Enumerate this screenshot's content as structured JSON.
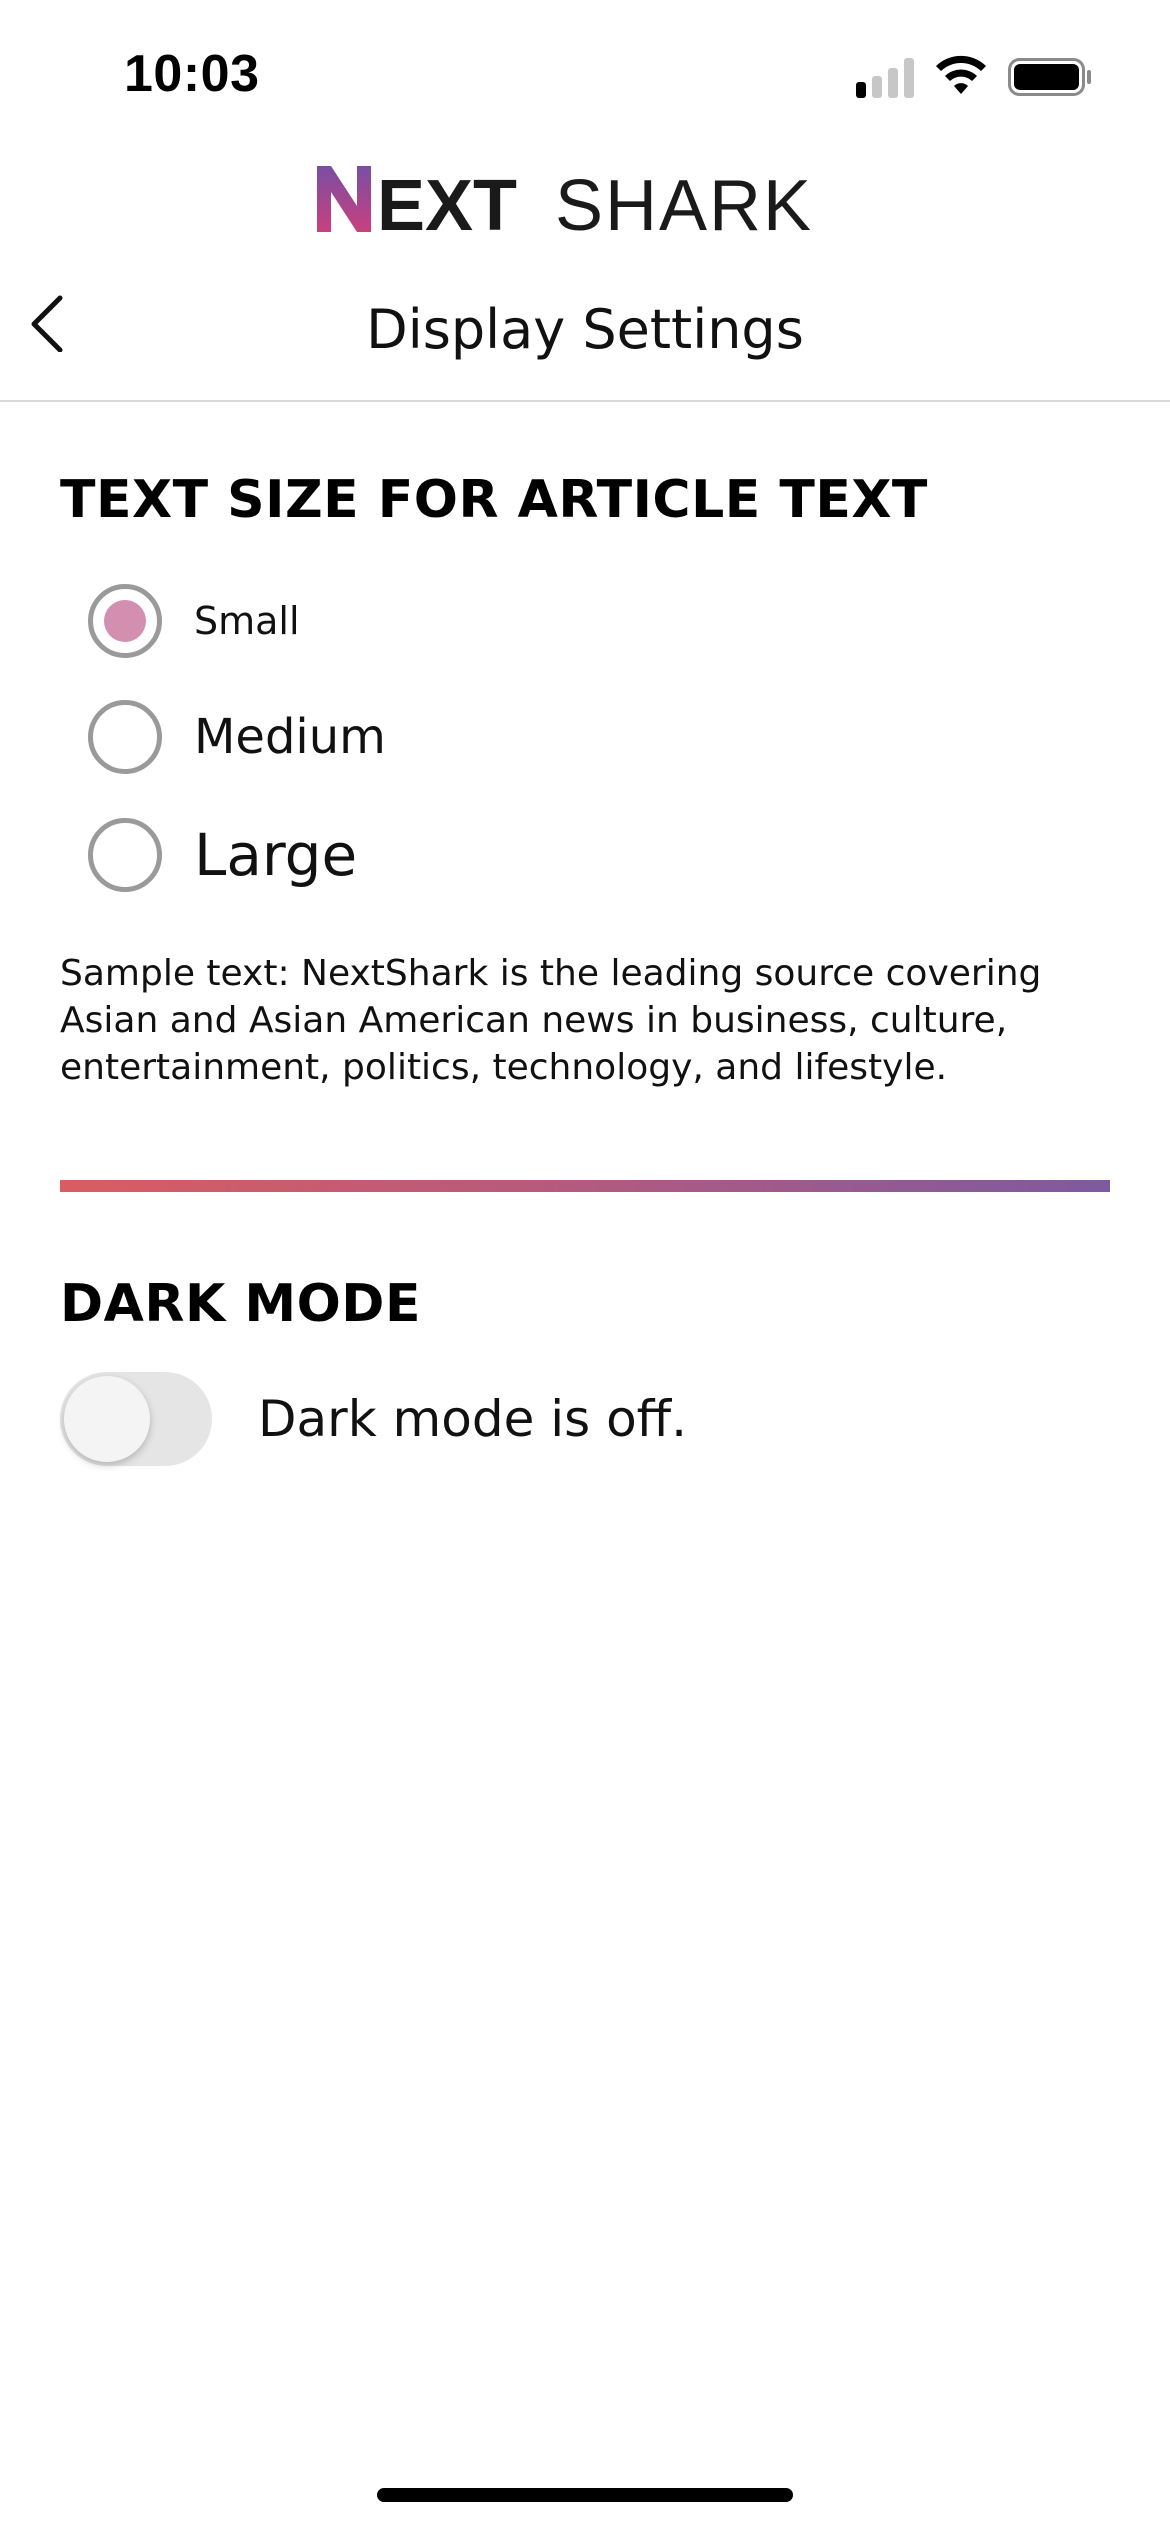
{
  "status_bar": {
    "time": "10:03",
    "signal_bars_active": 1,
    "signal_bars_total": 4
  },
  "logo": {
    "text_prefix": "N",
    "text_bold": "EXT",
    "text_light": "SHARK",
    "accent_gradient": [
      "#7a4ea3",
      "#c9407e"
    ]
  },
  "nav": {
    "title": "Display Settings",
    "back_icon": "chevron-left-icon"
  },
  "text_size": {
    "heading": "TEXT SIZE FOR ARTICLE TEXT",
    "options": [
      {
        "label": "Small",
        "selected": true
      },
      {
        "label": "Medium",
        "selected": false
      },
      {
        "label": "Large",
        "selected": false
      }
    ],
    "sample": "Sample text: NextShark is the leading source covering Asian and Asian American news in business, culture, entertainment, politics, technology, and lifestyle.",
    "radio_selected_color": "#d28fb0"
  },
  "divider": {
    "gradient": [
      "#d95d62",
      "#7d5aa0"
    ]
  },
  "dark_mode": {
    "heading": "DARK MODE",
    "enabled": false,
    "status": "Dark mode is off."
  }
}
